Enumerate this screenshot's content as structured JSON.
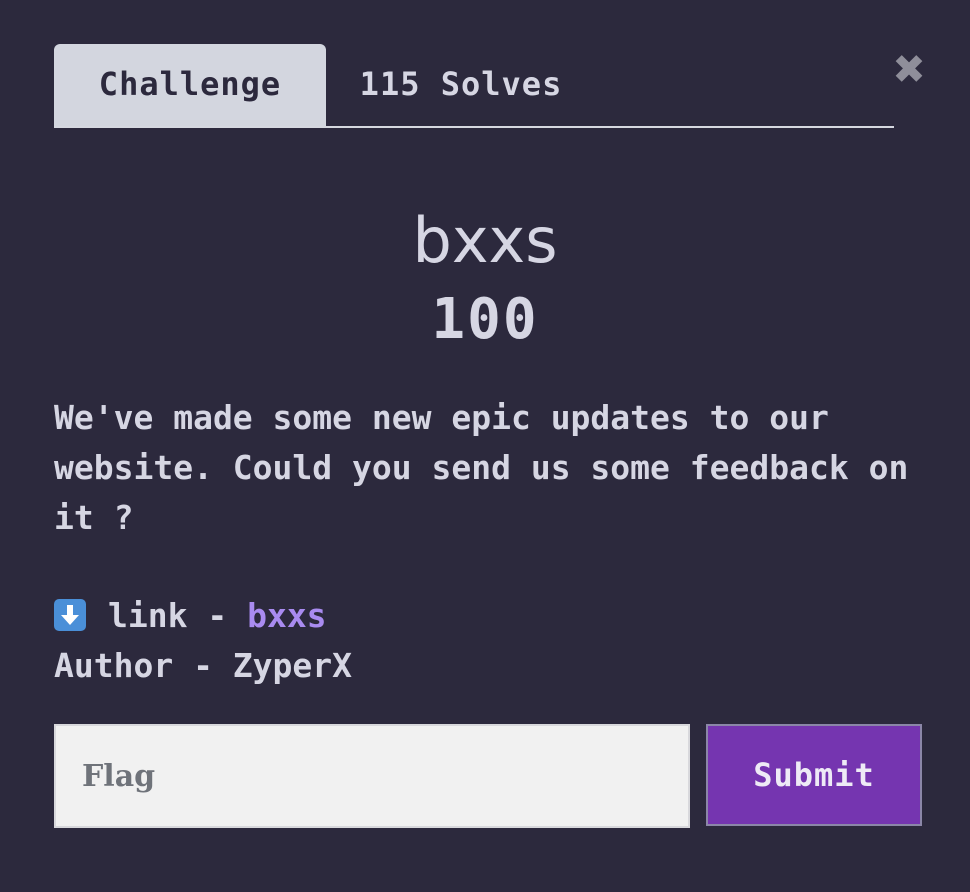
{
  "tabs": {
    "challenge_label": "Challenge",
    "solves_label": "115 Solves"
  },
  "close": {
    "glyph": "✖"
  },
  "challenge": {
    "name": "bxxs",
    "value": "100",
    "description": "We've made some new epic updates to our website. Could you send us some feedback on it ?",
    "link_prefix": "link - ",
    "link_text": "bxxs",
    "author_line": "Author - ZyperX",
    "link_icon": "down-arrow-icon"
  },
  "form": {
    "flag_placeholder": "Flag",
    "flag_value": "",
    "submit_label": "Submit"
  },
  "colors": {
    "background": "#2c293d",
    "text": "#d6d6e3",
    "link": "#a98bf0",
    "submit": "#7535b0",
    "active_tab": "#d3d6df"
  }
}
